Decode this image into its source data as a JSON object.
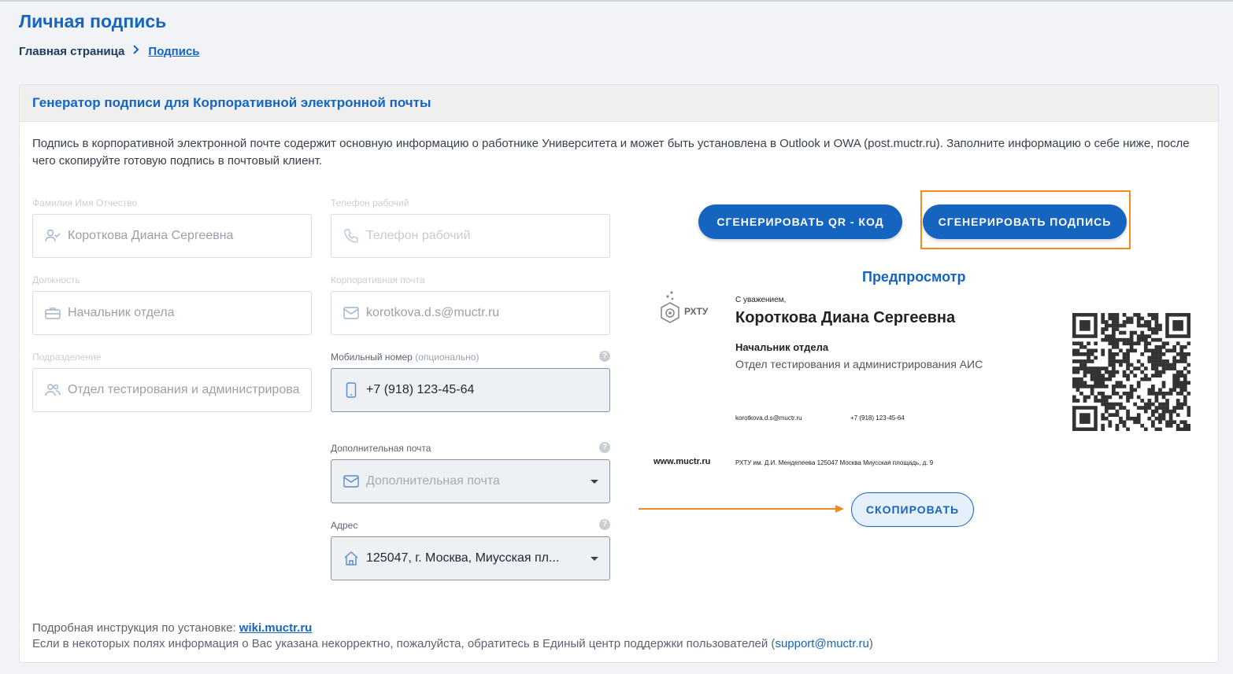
{
  "page": {
    "title": "Личная подпись",
    "breadcrumb": {
      "home": "Главная страница",
      "separator": ">",
      "current": "Подпись"
    }
  },
  "card": {
    "title": "Генератор подписи для Корпоративной электронной почты",
    "intro": "Подпись в корпоративной электронной почте содержит основную информацию о работнике Университета и может быть установлена в Outlook и OWA (post.muctr.ru). Заполните информацию о себе ниже, после чего скопируйте готовую подпись в почтовый клиент."
  },
  "form": {
    "fio": {
      "label": "Фамилия Имя Отчество",
      "value": "Короткова Диана Сергеевна",
      "icon": "user-check-icon"
    },
    "position": {
      "label": "Должность",
      "value": "Начальник отдела",
      "icon": "briefcase-icon"
    },
    "department": {
      "label": "Подразделение",
      "value": "Отдел тестирования и администрирования АИС",
      "icon": "users-icon"
    },
    "work_phone": {
      "label": "Телефон рабочий",
      "placeholder": "Телефон рабочий",
      "icon": "phone-icon"
    },
    "corp_email": {
      "label": "Корпоративная почта",
      "value": "korotkova.d.s@muctr.ru",
      "icon": "mail-icon"
    },
    "mobile": {
      "label": "Мобильный номер",
      "optional": "(опционально)",
      "value": "+7 (918) 123-45-64",
      "icon": "smartphone-icon"
    },
    "extra_email": {
      "label": "Дополнительная почта",
      "placeholder": "Дополнительная почта",
      "icon": "mail-icon"
    },
    "address": {
      "label": "Адрес",
      "value": "125047, г. Москва, Миусская пл...",
      "icon": "home-icon"
    },
    "help_glyph": "?"
  },
  "actions": {
    "generate_qr": "СГЕНЕРИРОВАТЬ QR - КОД",
    "generate_signature": "СГЕНЕРИРОВАТЬ ПОДПИСЬ",
    "copy": "СКОПИРОВАТЬ"
  },
  "preview": {
    "title": "Предпросмотр",
    "logo_text": "РХТУ",
    "greeting": "С уважением,",
    "name": "Короткова Диана Сергеевна",
    "position": "Начальник отдела",
    "department": "Отдел тестирования и администрирования АИС",
    "email": "korotkova.d.s@muctr.ru",
    "phone": "+7 (918) 123-45-64",
    "site": "www.muctr.ru",
    "address": "РХТУ им. Д.И. Менделеева 125047 Москва Миусская площадь, д. 9"
  },
  "footer": {
    "instruction_prefix": "Подробная инструкция по установке:",
    "wiki_link": "wiki.muctr.ru",
    "support_prefix": "Если в некоторых полях информация о Вас указана некорректно, пожалуйста, обратитесь в Единый центр поддержки пользователей (",
    "support_link": "support@muctr.ru",
    "support_suffix": ")"
  },
  "colors": {
    "accent": "#1565c0",
    "highlight": "#f28a1c"
  }
}
